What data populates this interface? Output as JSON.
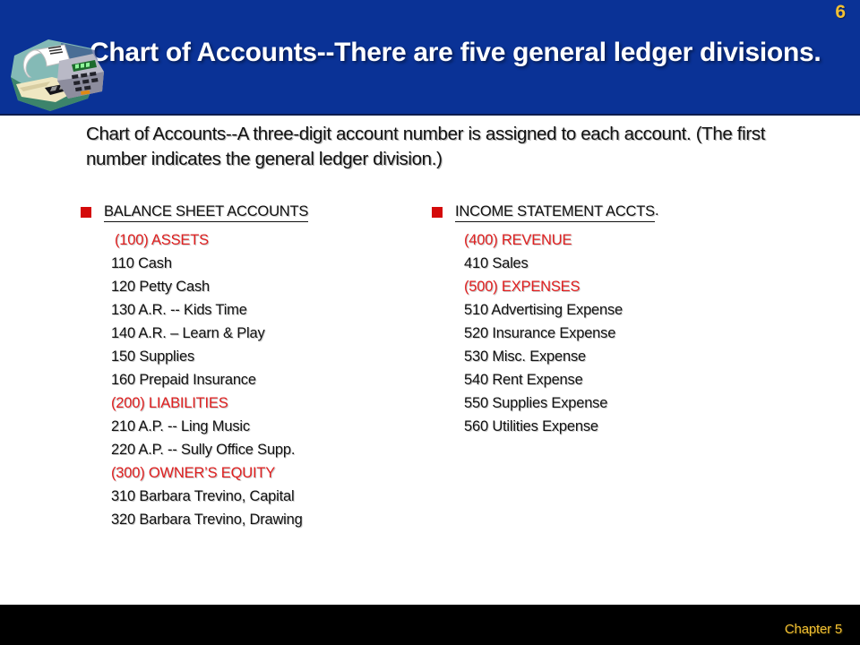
{
  "slide": {
    "number": "6",
    "title": "Chart of Accounts--There are five general ledger divisions.",
    "subtitle": "Chart of Accounts--A three-digit account number is assigned to each account. (The first number indicates the general ledger division.)",
    "footer": "Chapter 5"
  },
  "colors": {
    "title_band": "#0a3296",
    "title_text": "#ffffff",
    "slide_number": "#f2c033",
    "bullet": "#d40a0a",
    "division_heading": "#e02020",
    "account_text": "#111111",
    "footer_bar": "#000000",
    "footer_text": "#f2c033"
  },
  "columns": {
    "left": {
      "heading": "BALANCE SHEET ACCOUNTS",
      "heading_tail": "",
      "groups": [
        {
          "division": "(100) ASSETS",
          "accounts": [
            "110 Cash",
            "120 Petty Cash",
            "130 A.R. -- Kids Time",
            "140 A.R. – Learn & Play",
            "150 Supplies",
            "160 Prepaid Insurance"
          ]
        },
        {
          "division": " (200) LIABILITIES",
          "accounts": [
            "210 A.P. -- Ling Music",
            "220 A.P. -- Sully Office Supp."
          ]
        },
        {
          "division": "(300) OWNER’S EQUITY",
          "accounts": [
            "310 Barbara Trevino, Capital",
            "320 Barbara Trevino, Drawing"
          ]
        }
      ]
    },
    "right": {
      "heading": "INCOME STATEMENT ACCTS",
      "heading_tail": ".",
      "groups": [
        {
          "division": "(400) REVENUE",
          "accounts": [
            "410 Sales"
          ]
        },
        {
          "division": "(500) EXPENSES",
          "accounts": [
            "510 Advertising Expense",
            "520 Insurance Expense",
            "530 Misc.  Expense",
            "540 Rent Expense",
            "550 Supplies Expense",
            "560 Utilities Expense"
          ]
        }
      ]
    }
  },
  "clipart": {
    "name": "adding-machine-clipart",
    "description": "Adding machine with paper tape on teal background"
  }
}
